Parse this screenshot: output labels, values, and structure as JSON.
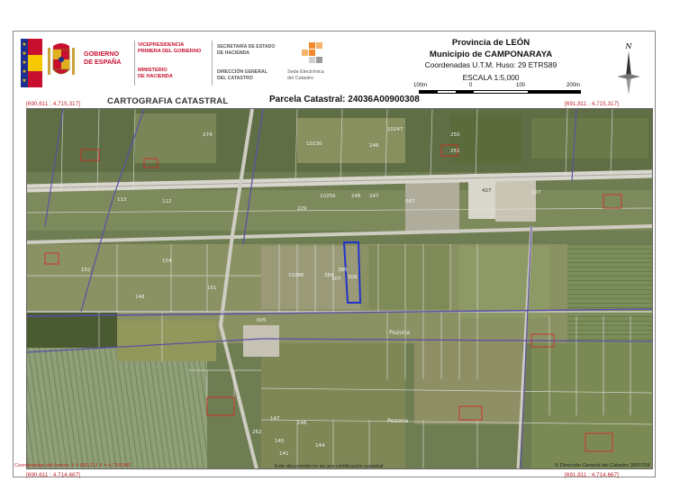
{
  "header": {
    "gobierno_line1": "GOBIERNO",
    "gobierno_line2": "DE ESPAÑA",
    "vice_line1": "VICEPRESIDENCIA",
    "vice_line2": "PRIMERA DEL GOBIERNO",
    "ministerio_line1": "MINISTERIO",
    "ministerio_line2": "DE HACIENDA",
    "secretaria_line1": "SECRETARÍA DE ESTADO",
    "secretaria_line2": "DE HACIENDA",
    "direccion_line1": "DIRECCIÓN GENERAL",
    "direccion_line2": "DEL CATASTRO",
    "sede_line1": "Sede Electrónica",
    "sede_line2": "del Catastro",
    "provincia": "Provincia de LEÓN",
    "municipio": "Municipio de CAMPONARAYA",
    "coordenadas": "Coordenadas U.T.M. Huso: 29 ETRS89",
    "escala": "ESCALA 1:5,000",
    "scale_ticks": [
      "100m",
      "0",
      "100",
      "200m"
    ],
    "north_label": "N",
    "cartografia": "CARTOGRAFIA CATASTRAL",
    "parcela": "Parcela Catastral: 24036A00900308"
  },
  "corners": {
    "top_left": "[690,611 ; 4,715,317]",
    "top_right": "[691,811 ; 4,715,317]",
    "bottom_left": "[690,611 ; 4,714,667]",
    "bottom_right": "[691,811 ; 4,714,667]"
  },
  "map": {
    "parcel_labels": [
      "274",
      "10230",
      "246",
      "10247",
      "250",
      "251",
      "248",
      "247",
      "427",
      "067",
      "113",
      "112",
      "10256",
      "229",
      "227",
      "384",
      "385",
      "10286",
      "307",
      "308",
      "005",
      "152",
      "148",
      "154",
      "151",
      "262",
      "147",
      "146",
      "145",
      "144",
      "141"
    ],
    "place_labels": [
      "Pozona",
      "Pozona"
    ],
    "colors": {
      "parcel_highlight": "#2233cc",
      "boundary_red": "#d22",
      "boundary_purple": "#5b4ea8"
    }
  },
  "footer": {
    "center_coords": "Coordenadas del centro: X = 691,211 Y = 4,714,992",
    "disclaimer": "Este documento no es una certificación catastral",
    "copyright": "© Dirección General del Catastro 30/07/24"
  }
}
